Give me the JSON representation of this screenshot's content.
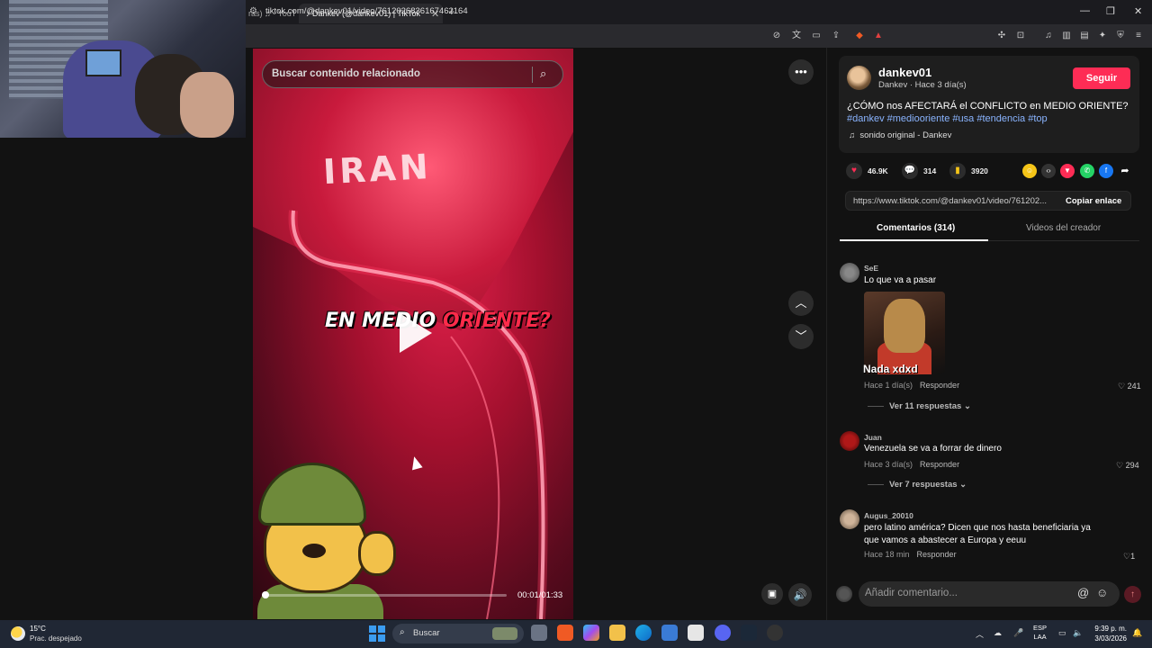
{
  "browser": {
    "tabs": [
      {
        "title": "ras) ♫ - YouT",
        "active": false
      },
      {
        "title": "Dankev (@dankev01) | TikTok",
        "active": true
      }
    ],
    "url": "tiktok.com/@dankev01/video/7612026836167462164"
  },
  "video": {
    "search_placeholder": "Buscar contenido relacionado",
    "map_label": "IRAN",
    "overlay_text_white": "EN MEDIO ",
    "overlay_text_red": "ORIENTE?",
    "time": "00:01/01:33",
    "progress": 0.01
  },
  "post": {
    "username": "dankev01",
    "subline": "Dankev · Hace 3 día(s)",
    "follow_label": "Seguir",
    "caption": "¿CÓMO nos AFECTARÁ el CONFLICTO en MEDIO ORIENTE?",
    "hashtags": "#dankev #mediooriente #usa #tendencia #top",
    "sound": "sonido original - Dankev",
    "likes": "46.9K",
    "comments": "314",
    "saves": "3920",
    "share_url": "https://www.tiktok.com/@dankev01/video/761202...",
    "copy_label": "Copiar enlace"
  },
  "panel_tabs": {
    "comments": "Comentarios (314)",
    "creator_videos": "Videos del creador"
  },
  "comments": [
    {
      "user": "SeE",
      "text": "Lo que va a pasar",
      "gif_caption": "Nada xdxd",
      "time": "Hace 1 día(s)",
      "reply": "Responder",
      "likes": "241",
      "more": "Ver 11 respuestas"
    },
    {
      "user": "Juan",
      "text": "Venezuela se va a forrar de dinero",
      "time": "Hace 3 día(s)",
      "reply": "Responder",
      "likes": "294",
      "more": "Ver 7 respuestas"
    },
    {
      "user": "Augus_20010",
      "text": "pero latino américa? Dicen que nos hasta beneficiaria ya que vamos a abastecer a Europa y eeuu",
      "time": "Hace 18 min",
      "reply": "Responder",
      "likes": "1"
    }
  ],
  "comment_input": {
    "placeholder": "Añadir comentario..."
  },
  "taskbar": {
    "temp": "15°C",
    "weather": "Prac. despejado",
    "search_label": "Buscar",
    "lang_top": "ESP",
    "lang_bottom": "LAA",
    "time": "9:39 p. m.",
    "date": "3/03/2026"
  },
  "colors": {
    "accent": "#fe2c55",
    "hashtag": "#8ab4ff",
    "taskbar": "#202734"
  }
}
